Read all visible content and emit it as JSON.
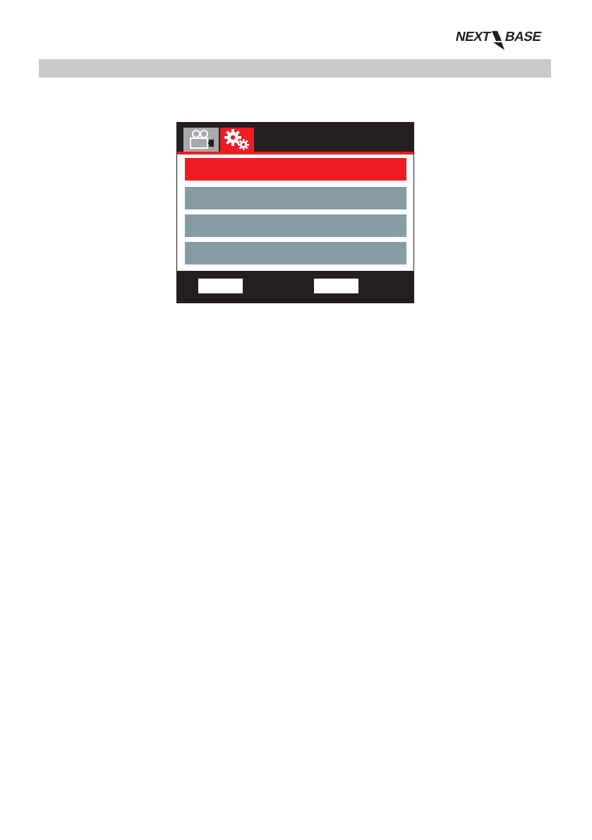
{
  "brand": {
    "logo_text": "NEXT BASE",
    "accent_color": "#ed1c24"
  },
  "screen": {
    "tabs": [
      {
        "icon": "video-camera-icon",
        "selected": false
      },
      {
        "icon": "gears-icon",
        "selected": true
      }
    ],
    "menu_items": [
      {
        "selected": true
      },
      {
        "selected": false
      },
      {
        "selected": false
      },
      {
        "selected": false
      }
    ],
    "colors": {
      "background": "#231f20",
      "selected_item": "#ed1c24",
      "item": "#879ba3",
      "inactive_tab": "#a7a9ac"
    }
  }
}
